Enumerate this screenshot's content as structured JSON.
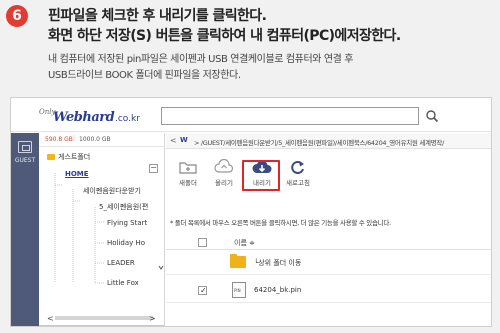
{
  "step": {
    "number": "6",
    "heading_line1": "핀파일을 체크한 후 내리기를 클릭한다.",
    "heading_line2": "화면 하단 저장(S) 버튼을 클릭하여 내 컴퓨터(PC)에저장한다.",
    "desc_line1": "내 컴퓨터에 저장된 pin파일은  세이펜과 USB 연결케이블로 컴퓨터와 연결 후",
    "desc_line2": "USB드라이브 BOOK 폴더에 핀파일을 저장한다."
  },
  "app": {
    "logo_only": "Only",
    "logo_text": "Webhard",
    "logo_tld": ".co.kr",
    "search": {
      "value": "",
      "placeholder": ""
    }
  },
  "sidebar": {
    "guest_label": "GUEST",
    "storage_used": "590.8 GB",
    "storage_separator": "|",
    "storage_total": "1000.0 GB",
    "tree": [
      {
        "label": "게스트폴더"
      },
      {
        "label": "HOME"
      },
      {
        "label": "세이펜음원다운받기"
      },
      {
        "label": "5_세이펜음원(편"
      },
      {
        "label": "Flying Start"
      },
      {
        "label": "Holiday Ho"
      },
      {
        "label": "LEADER"
      },
      {
        "label": "Little Fox"
      }
    ],
    "collapse_symbol": "−",
    "scroll_left": "<",
    "scroll_right": ">"
  },
  "main": {
    "path_back": "<",
    "path_home": "W",
    "path": "> /GUEST/세이펜음원다운받기/5_세이펜음원(편파일)/세이펜북스/64204_영어유치원 세계명작/",
    "toolbar": [
      {
        "label": "새폴더",
        "icon": "folder-plus-icon"
      },
      {
        "label": "올리기",
        "icon": "cloud-upload-icon"
      },
      {
        "label": "내리기",
        "icon": "cloud-download-icon"
      },
      {
        "label": "새로고침",
        "icon": "refresh-icon"
      }
    ],
    "hint": "* 폴더 목록에서 마우스 오른쪽 버튼을 클릭하시면, 더 많은 기능을 사용할 수 있습니다.",
    "list_header": "이름 ≑",
    "rows": [
      {
        "label": "└상위 폴더 이동",
        "type": "parent-folder"
      },
      {
        "label": "64204_bk.pin",
        "type": "file",
        "file_tag": "PIN",
        "checked": true
      }
    ]
  },
  "colors": {
    "step_badge": "#e03c31",
    "highlight": "#e0242a",
    "download_icon": "#3c4b7f",
    "folder": "#f0b21a",
    "nav_strip": "#4f5a78",
    "brand": "#2b3d8f"
  }
}
